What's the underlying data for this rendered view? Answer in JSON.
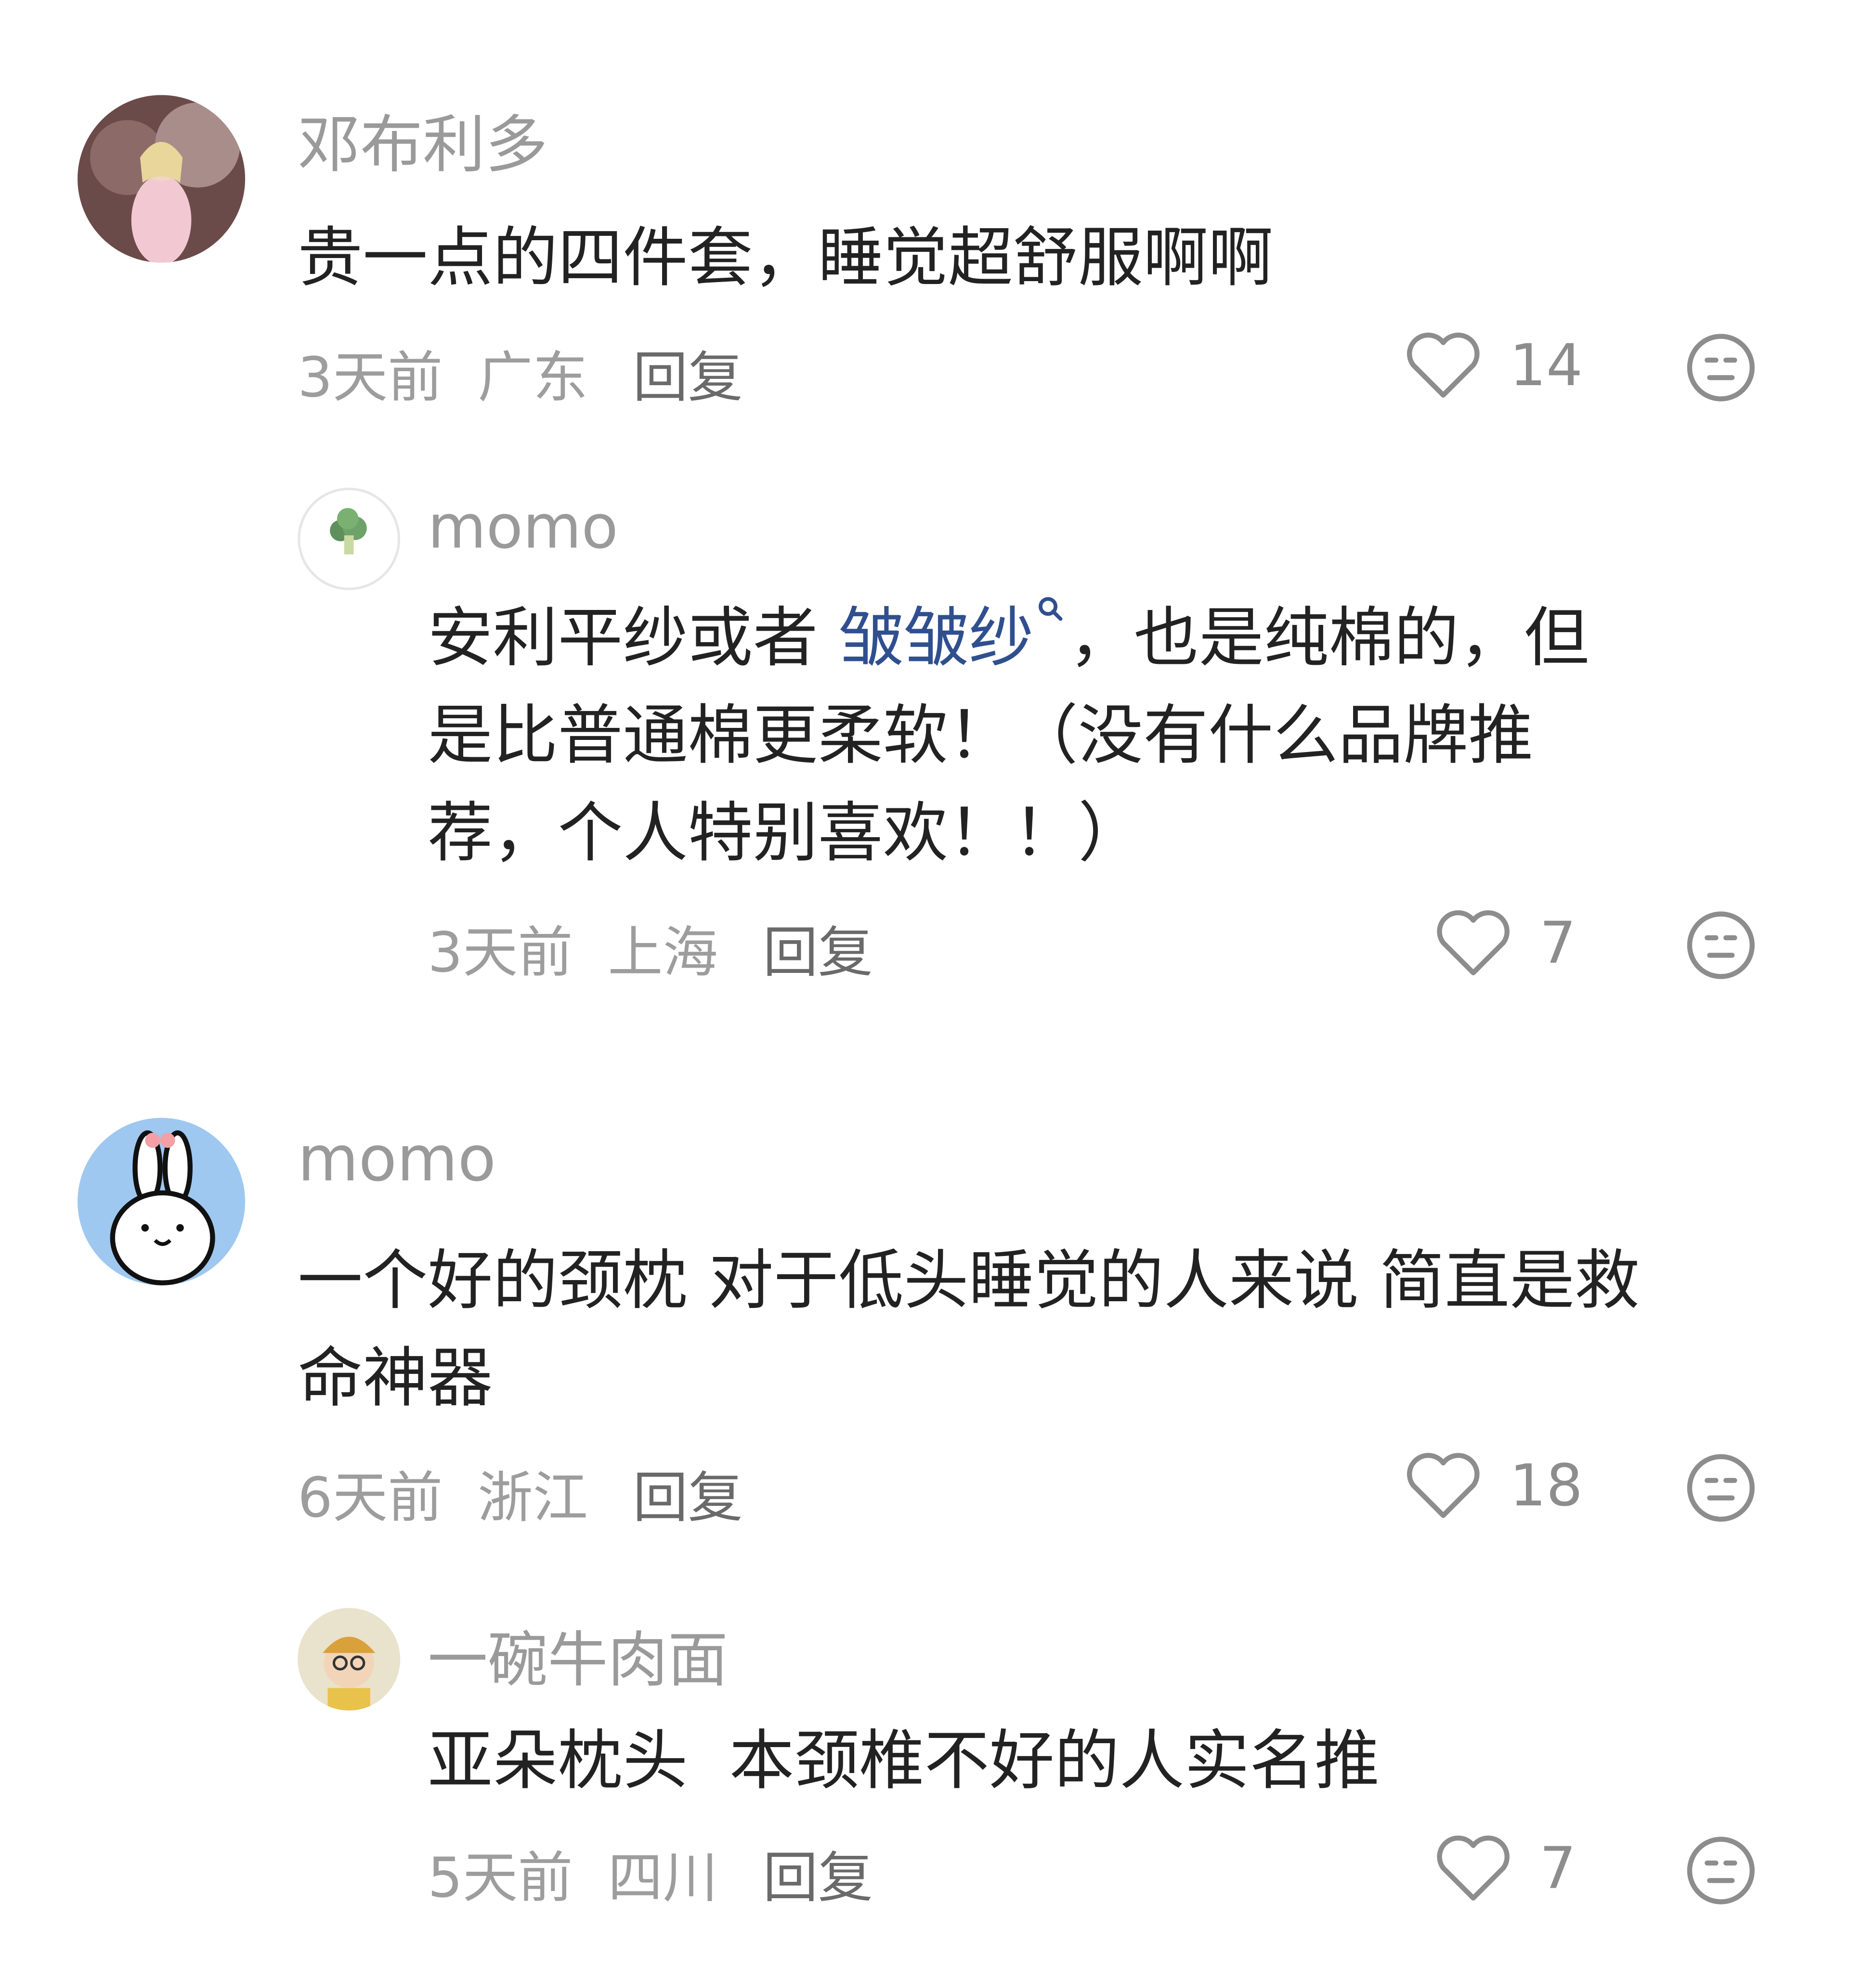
{
  "comments": [
    {
      "user": "邓布利多",
      "text": "贵一点的四件套，睡觉超舒服啊啊",
      "time": "3天前",
      "location": "广东",
      "reply_label": "回复",
      "likes": "14",
      "replies": [
        {
          "user": "momo",
          "text_before": "安利平纱或者 ",
          "link_text": "皱皱纱",
          "text_after_line1": "，也是纯棉的，但",
          "text_line2": "是比普通棉更柔软！（没有什么品牌推",
          "text_line3": "荐，个人特别喜欢！！）",
          "time": "3天前",
          "location": "上海",
          "reply_label": "回复",
          "likes": "7"
        }
      ]
    },
    {
      "user": "momo",
      "text_line1": "一个好的颈枕 对于低头睡觉的人来说 简直是救",
      "text_line2": "命神器",
      "time": "6天前",
      "location": "浙江",
      "reply_label": "回复",
      "likes": "18",
      "replies": [
        {
          "user": "一碗牛肉面",
          "text": "亚朵枕头  本颈椎不好的人实名推",
          "time": "5天前",
          "location": "四川",
          "reply_label": "回复",
          "likes": "7"
        }
      ]
    }
  ]
}
